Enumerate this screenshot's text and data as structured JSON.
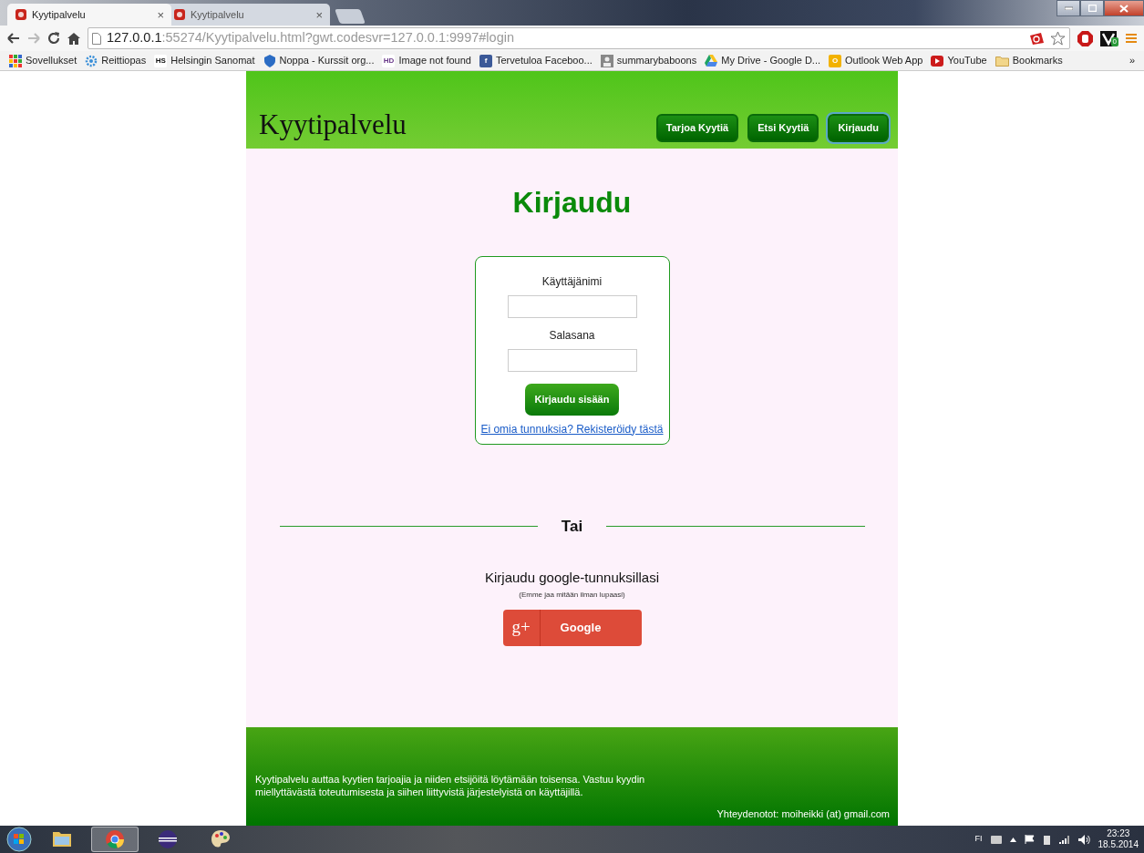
{
  "browser": {
    "tabs": [
      {
        "title": "Kyytipalvelu",
        "selected": true,
        "close": "×"
      },
      {
        "title": "Kyytipalvelu",
        "selected": false,
        "close": "×"
      }
    ],
    "address": {
      "host": "127.0.0.1",
      "rest": ":55274/Kyytipalvelu.html?gwt.codesvr=127.0.0.1:9997#login"
    },
    "extension_badge": "0",
    "bookmarks": [
      {
        "label": "Sovellukset",
        "kind": "apps"
      },
      {
        "label": "Reittiopas",
        "kind": "gear"
      },
      {
        "label": "Helsingin Sanomat",
        "kind": "letters",
        "icon_text": "HS"
      },
      {
        "label": "Noppa - Kurssit org...",
        "kind": "shield"
      },
      {
        "label": "Image not found",
        "kind": "letters",
        "icon_text": "HD"
      },
      {
        "label": "Tervetuloa Faceboo...",
        "kind": "social",
        "icon_text": "f"
      },
      {
        "label": "summarybaboons",
        "kind": "person"
      },
      {
        "label": "My Drive - Google D...",
        "kind": "drive"
      },
      {
        "label": "Outlook Web App",
        "kind": "mail",
        "icon_text": "O"
      },
      {
        "label": "YouTube",
        "kind": "play"
      },
      {
        "label": "Bookmarks",
        "kind": "folder"
      }
    ],
    "bookmarks_overflow": "»"
  },
  "site": {
    "title": "Kyytipalvelu",
    "nav": [
      {
        "label": "Tarjoa Kyytiä",
        "selected": false
      },
      {
        "label": "Etsi Kyytiä",
        "selected": false
      },
      {
        "label": "Kirjaudu",
        "selected": true
      }
    ],
    "heading": "Kirjaudu",
    "form": {
      "fields": [
        {
          "label": "Käyttäjänimi"
        },
        {
          "label": "Salasana"
        }
      ],
      "submit": "Kirjaudu sisään",
      "register_link": "Ei omia tunnuksia? Rekisteröidy tästä"
    },
    "divider": "Tai",
    "google": {
      "title": "Kirjaudu google-tunnuksillasi",
      "note": "(Emme jaa mitään ilman lupaasi)",
      "glyph": "g+",
      "button": "Google"
    },
    "footer": {
      "description": "Kyytipalvelu auttaa kyytien tarjoajia ja niiden etsijöitä löytämään toisensa. Vastuu kyydin miellyttävästä toteutumisesta ja siihen liittyvistä järjestelyistä on käyttäjillä.",
      "contact": "Yhteydenotot: moiheikki (at) gmail.com"
    }
  },
  "taskbar": {
    "apps": [
      {
        "kind": "explorer",
        "selected": false
      },
      {
        "kind": "chrome",
        "selected": true
      },
      {
        "kind": "eclipse",
        "selected": false
      },
      {
        "kind": "paint",
        "selected": false
      }
    ],
    "language": "FI",
    "time": "23:23",
    "date": "18.5.2014"
  }
}
